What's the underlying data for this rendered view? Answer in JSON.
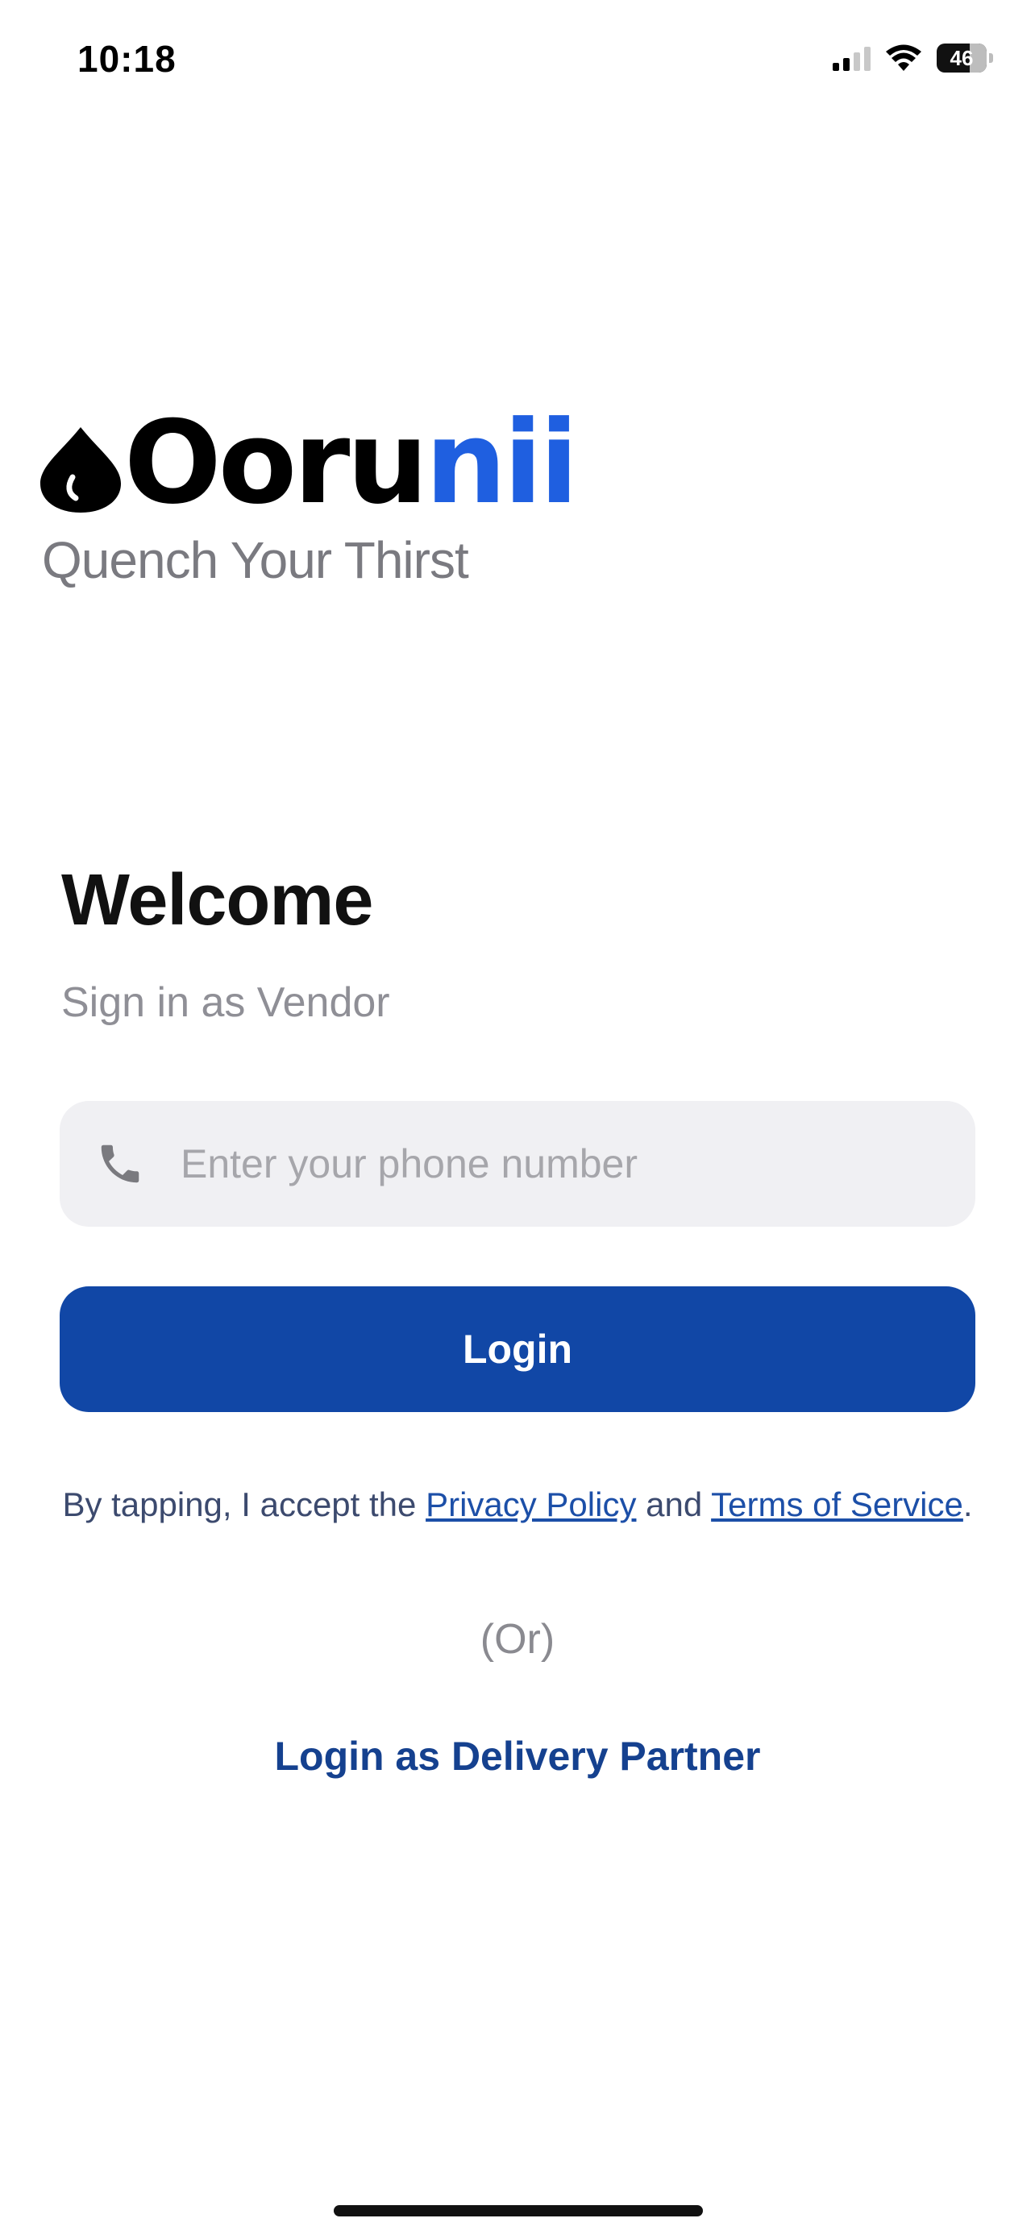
{
  "status_bar": {
    "time": "10:18",
    "battery": "46",
    "signal_icon": "cellular-signal-icon",
    "wifi_icon": "wifi-icon",
    "battery_icon": "battery-icon"
  },
  "brand": {
    "name_main": "Ooru",
    "name_accent": "nii",
    "tagline": "Quench Your Thirst",
    "accent_color": "#1f5fe0",
    "logo_icon": "water-drop-icon"
  },
  "welcome": {
    "title": "Welcome",
    "subtitle": "Sign in as Vendor"
  },
  "phone_input": {
    "placeholder": "Enter your phone number",
    "value": "",
    "icon": "phone-icon"
  },
  "login_button": {
    "label": "Login",
    "color": "#1147a6"
  },
  "legal": {
    "prefix": "By tapping, I accept the ",
    "privacy_link": "Privacy Policy",
    "conjunction": " and ",
    "terms_link": "Terms of Service",
    "suffix": "."
  },
  "or_separator": "(Or)",
  "delivery_partner_link": "Login as Delivery Partner"
}
